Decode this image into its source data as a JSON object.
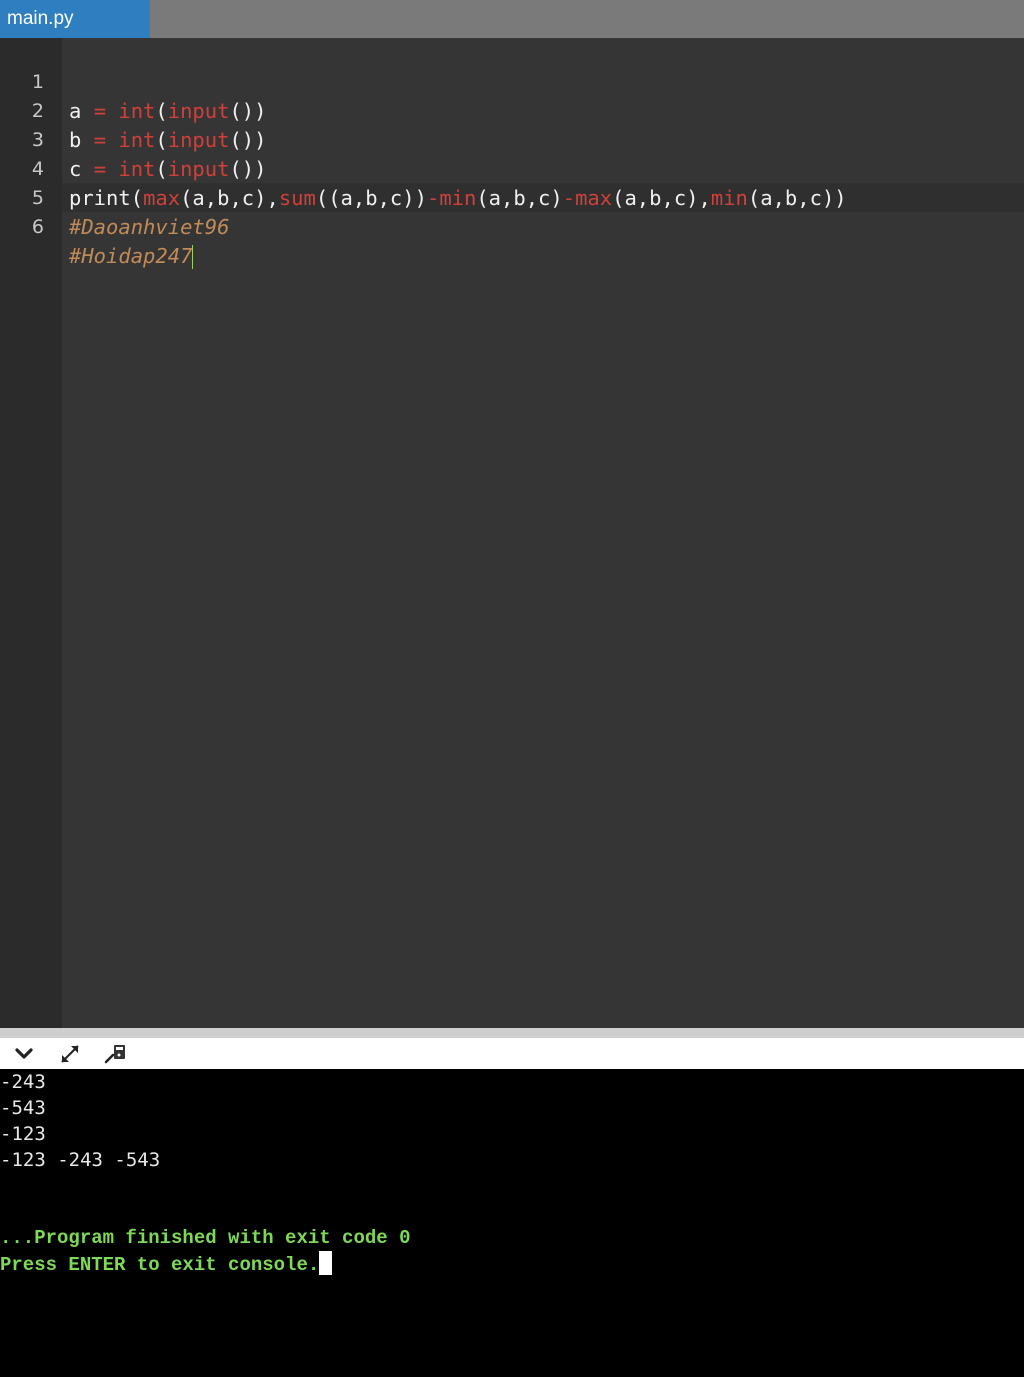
{
  "tab": {
    "filename": "main.py"
  },
  "editor": {
    "line_numbers": [
      "1",
      "2",
      "3",
      "4",
      "5",
      "6"
    ],
    "lines": [
      [
        {
          "t": "a ",
          "c": "id"
        },
        {
          "t": "=",
          "c": "op"
        },
        {
          "t": " ",
          "c": "id"
        },
        {
          "t": "int",
          "c": "fn"
        },
        {
          "t": "(",
          "c": "id"
        },
        {
          "t": "input",
          "c": "fn"
        },
        {
          "t": "())",
          "c": "id"
        }
      ],
      [
        {
          "t": "b ",
          "c": "id"
        },
        {
          "t": "=",
          "c": "op"
        },
        {
          "t": " ",
          "c": "id"
        },
        {
          "t": "int",
          "c": "fn"
        },
        {
          "t": "(",
          "c": "id"
        },
        {
          "t": "input",
          "c": "fn"
        },
        {
          "t": "())",
          "c": "id"
        }
      ],
      [
        {
          "t": "c ",
          "c": "id"
        },
        {
          "t": "=",
          "c": "op"
        },
        {
          "t": " ",
          "c": "id"
        },
        {
          "t": "int",
          "c": "fn"
        },
        {
          "t": "(",
          "c": "id"
        },
        {
          "t": "input",
          "c": "fn"
        },
        {
          "t": "())",
          "c": "id"
        }
      ],
      [
        {
          "t": "print(",
          "c": "id"
        },
        {
          "t": "max",
          "c": "fn"
        },
        {
          "t": "(a,b,c),",
          "c": "id"
        },
        {
          "t": "sum",
          "c": "fn"
        },
        {
          "t": "((a,b,c))",
          "c": "id"
        },
        {
          "t": "-",
          "c": "op"
        },
        {
          "t": "min",
          "c": "fn"
        },
        {
          "t": "(a,b,c)",
          "c": "id"
        },
        {
          "t": "-",
          "c": "op"
        },
        {
          "t": "max",
          "c": "fn"
        },
        {
          "t": "(a,b,c),",
          "c": "id"
        },
        {
          "t": "min",
          "c": "fn"
        },
        {
          "t": "(a,b,c))",
          "c": "id"
        }
      ],
      [
        {
          "t": "#Daoanhviet96",
          "c": "cm"
        }
      ],
      [
        {
          "t": "#Hoidap247",
          "c": "cm"
        }
      ]
    ],
    "cursor_line": 6
  },
  "console_toolbar": {
    "icons": [
      "chevron-down-icon",
      "expand-icon",
      "clear-console-icon"
    ]
  },
  "console": {
    "output_lines": [
      "-243",
      "-543",
      "-123",
      "-123 -243 -543"
    ],
    "status_line": "...Program finished with exit code 0",
    "prompt_line": "Press ENTER to exit console."
  },
  "colors": {
    "tab_active": "#2f7ec0",
    "editor_bg": "#353535",
    "keyword_red": "#d0403a",
    "comment": "#c08b58",
    "console_green": "#7ed957"
  }
}
